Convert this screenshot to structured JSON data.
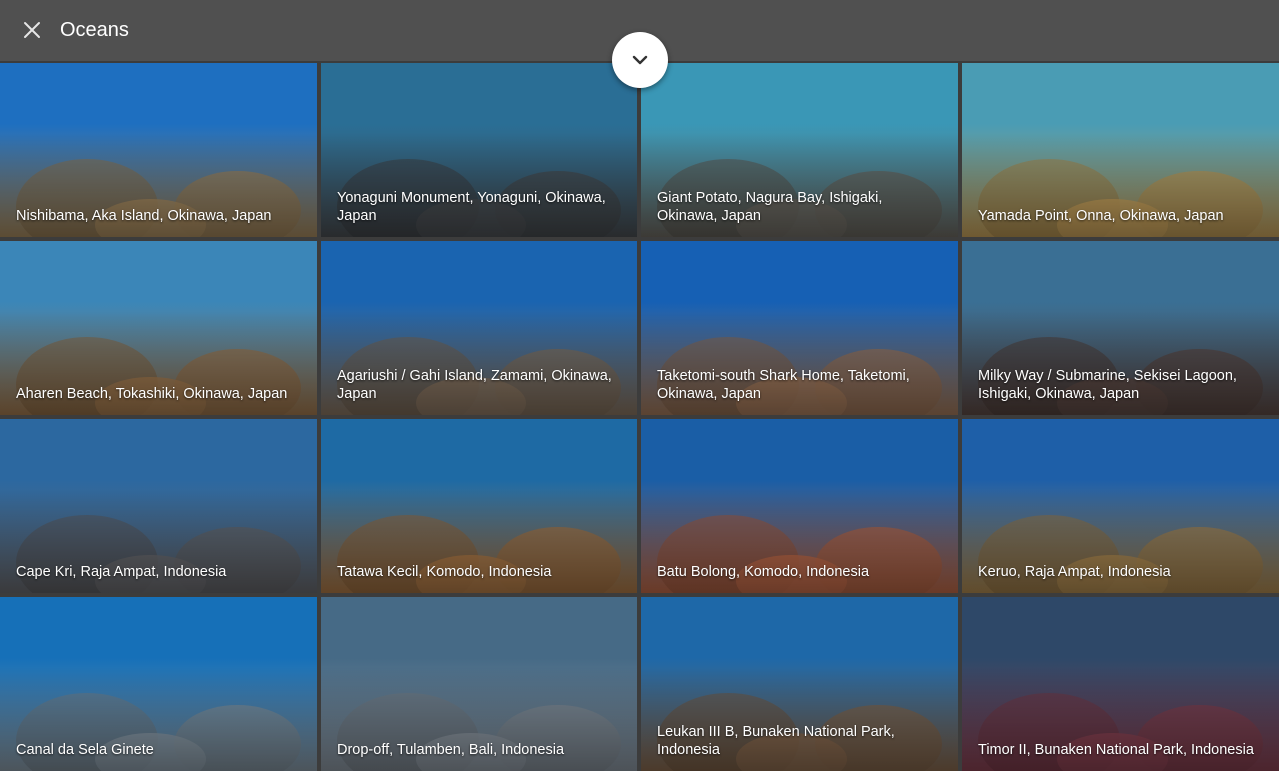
{
  "header": {
    "title": "Oceans",
    "close_icon": "close-icon",
    "collapse_icon": "chevron-down-icon"
  },
  "tiles": [
    {
      "label": "Nishibama, Aka Island, Okinawa, Japan",
      "water": "#1e6fc0",
      "reef": "#a88a5e"
    },
    {
      "label": "Yonaguni Monument, Yonaguni, Okinawa, Japan",
      "water": "#2a6e95",
      "reef": "#4a4e52"
    },
    {
      "label": "Giant Potato, Nagura Bay, Ishigaki, Okinawa, Japan",
      "water": "#3a97b6",
      "reef": "#6e6a62"
    },
    {
      "label": "Yamada Point, Onna, Okinawa, Japan",
      "water": "#4a9cb4",
      "reef": "#c9a25a"
    },
    {
      "label": "Aharen Beach, Tokashiki, Okinawa, Japan",
      "water": "#3b86b8",
      "reef": "#a47a4e"
    },
    {
      "label": "Agariushi / Gahi Island, Zamami, Okinawa, Japan",
      "water": "#1a64b0",
      "reef": "#8a7560"
    },
    {
      "label": "Taketomi-south Shark Home, Taketomi, Okinawa, Japan",
      "water": "#1660b4",
      "reef": "#a57a5a"
    },
    {
      "label": "Milky Way / Submarine, Sekisei Lagoon, Ishigaki, Okinawa, Japan",
      "water": "#3a6f94",
      "reef": "#5e4a44"
    },
    {
      "label": "Cape Kri, Raja Ampat, Indonesia",
      "water": "#2c68a0",
      "reef": "#6a6a6e"
    },
    {
      "label": "Tatawa Kecil, Komodo, Indonesia",
      "water": "#1e6aa4",
      "reef": "#b07a46"
    },
    {
      "label": "Batu Bolong, Komodo, Indonesia",
      "water": "#1a5ea6",
      "reef": "#c06a48"
    },
    {
      "label": "Keruo, Raja Ampat, Indonesia",
      "water": "#1e5fa8",
      "reef": "#b08a50"
    },
    {
      "label": "Canal da Sela Ginete",
      "water": "#1670b8",
      "reef": "#8a9aa6"
    },
    {
      "label": "Drop-off, Tulamben, Bali, Indonesia",
      "water": "#466a86",
      "reef": "#8c96a0"
    },
    {
      "label": "Leukan III B, Bunaken National Park, Indonesia",
      "water": "#1e68a8",
      "reef": "#8a6a4e"
    },
    {
      "label": "Timor II, Bunaken National Park, Indonesia",
      "water": "#2e4868",
      "reef": "#8a4252"
    }
  ]
}
